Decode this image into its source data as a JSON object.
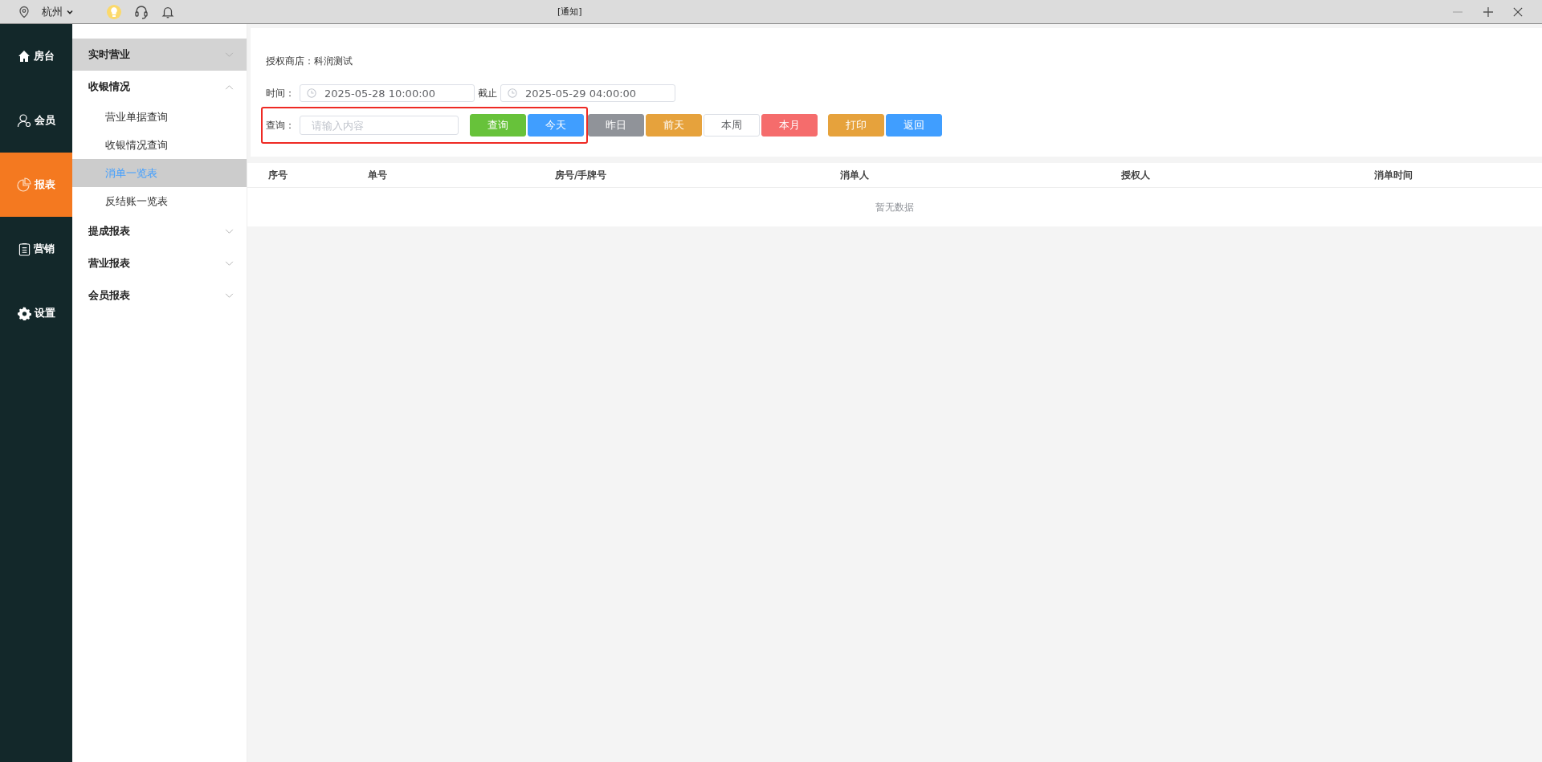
{
  "topbar": {
    "city": "杭州",
    "title": "[通知]"
  },
  "nav": [
    {
      "label": "房台",
      "selected": false
    },
    {
      "label": "会员",
      "selected": false
    },
    {
      "label": "报表",
      "selected": true
    },
    {
      "label": "营销",
      "selected": false
    },
    {
      "label": "设置",
      "selected": false
    }
  ],
  "submenu": [
    {
      "label": "实时营业",
      "expanded": false,
      "selected": true
    },
    {
      "label": "收银情况",
      "expanded": true,
      "selected": false,
      "children": [
        {
          "label": "营业单据查询",
          "selected": false
        },
        {
          "label": "收银情况查询",
          "selected": false
        },
        {
          "label": "消单一览表",
          "selected": true
        },
        {
          "label": "反结账一览表",
          "selected": false
        }
      ]
    },
    {
      "label": "提成报表",
      "expanded": false,
      "selected": false
    },
    {
      "label": "营业报表",
      "expanded": false,
      "selected": false
    },
    {
      "label": "会员报表",
      "expanded": false,
      "selected": false
    }
  ],
  "filters": {
    "store_label": "授权商店：",
    "store_name": "科润测试",
    "time_label": "时间：",
    "start": "2025-05-28 10:00:00",
    "until_label": "截止",
    "end": "2025-05-29 04:00:00",
    "query": {
      "label": "查询：",
      "placeholder": "请输入内容",
      "highlighted": true,
      "buttons": [
        {
          "label": "查询",
          "color": "#67c23a"
        },
        {
          "label": "今天",
          "color": "#409eff"
        }
      ]
    },
    "quick_buttons": [
      {
        "label": "昨日",
        "color": "#909399"
      },
      {
        "label": "前天",
        "color": "#e6a23c"
      },
      {
        "label": "本周",
        "color": "#ffffff"
      },
      {
        "label": "本月",
        "color": "#f56c6c"
      }
    ],
    "action_buttons": [
      {
        "label": "打印",
        "color": "#e6a23c"
      },
      {
        "label": "返回",
        "color": "#409eff"
      }
    ]
  },
  "table": {
    "columns": [
      "序号",
      "单号",
      "房号/手牌号",
      "消单人",
      "授权人",
      "消单时间"
    ],
    "empty_text": "暂无数据"
  }
}
